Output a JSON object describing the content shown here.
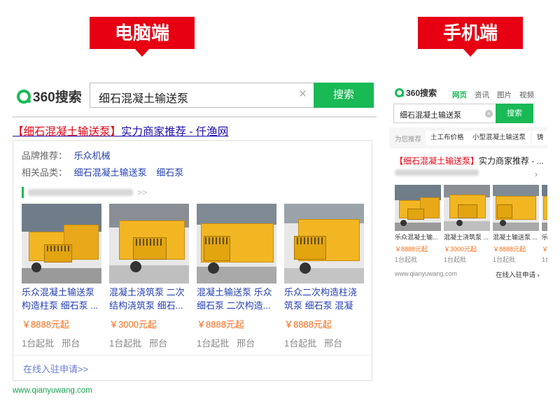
{
  "banners": {
    "pc": "电脑端",
    "mobile": "手机端"
  },
  "desktop": {
    "logo_text": "360搜索",
    "search_value": "细石混凝土输送泵",
    "clear_glyph": "×",
    "search_button": "搜索",
    "result_title_highlight": "【细石混凝土输送泵】",
    "result_title_rest": "实力商家推荐 - 仟渔网",
    "brand_label": "品牌推荐：",
    "brand_link": "乐众机械",
    "category_label": "相关品类：",
    "category_links": [
      "细石混凝土输送泵",
      "细石泵"
    ],
    "company_more": ">>",
    "products": [
      {
        "name": "乐众混凝土输送泵构造柱泵 细石泵 ...",
        "price": "￥8888元起",
        "moq": "1台起批",
        "unit": "邢台"
      },
      {
        "name": "混凝土浇筑泵 二次结构浇筑泵 细石...",
        "price": "￥3000元起",
        "moq": "1台起批",
        "unit": "邢台"
      },
      {
        "name": "混凝土输送泵 乐众细石泵 二次构造...",
        "price": "￥8888元起",
        "moq": "1台起批",
        "unit": "邢台"
      },
      {
        "name": "乐众二次构造柱浇筑泵 细石泵 混凝土...",
        "price": "￥8888元起",
        "moq": "1台起批",
        "unit": "邢台"
      }
    ],
    "join_link": "在线入驻申请>>",
    "domain": "www.qianyuwang.com"
  },
  "mobile": {
    "logo_text": "360搜索",
    "nav": [
      "网页",
      "资讯",
      "图片",
      "视频"
    ],
    "search_value": "细石混凝土输送泵",
    "clear_glyph": "×",
    "search_button": "搜索",
    "suggest_label": "为您推荐",
    "suggest_chips": [
      "土工布价格",
      "小型混凝土输送泵",
      "铸"
    ],
    "result_title_highlight": "【细石混凝土输送泵】",
    "result_title_rest": "实力商家推荐 - ...",
    "arrow": "›",
    "products": [
      {
        "name": "乐众混凝土输...",
        "price": "￥8888元起",
        "moq": "1台起批"
      },
      {
        "name": "混凝土浇筑泵 ...",
        "price": "￥3000元起",
        "moq": "1台起批"
      },
      {
        "name": "混凝土输送泵 ...",
        "price": "￥8888元起",
        "moq": "1台起批"
      },
      {
        "name": "乐...",
        "price": "￥8",
        "moq": "1台"
      }
    ],
    "domain": "www.qianyuwang.com",
    "join_link": "在线入驻申请 ›"
  },
  "colors": {
    "banner_red": "#e60012",
    "brand_green": "#19b955",
    "price_orange": "#f56b18",
    "link_blue": "#2440b3"
  }
}
